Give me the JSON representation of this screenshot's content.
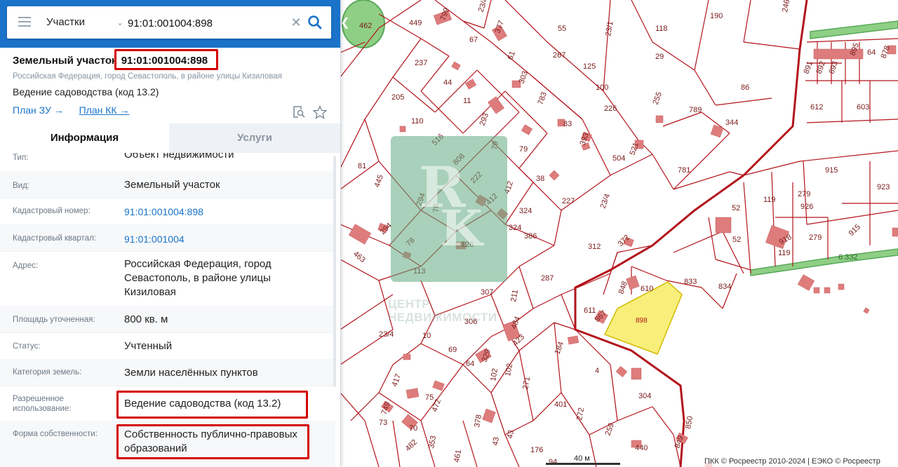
{
  "search": {
    "type_label": "Участки",
    "query": "91:01:001004:898"
  },
  "parcel": {
    "title_prefix": "Земельный участок",
    "number": "91:01:001004:898",
    "address_short": "Российская Федерация, город Севастополь, в районе улицы Кизиловая",
    "use": "Ведение садоводства (код 13.2)",
    "links": [
      "План ЗУ →",
      "План КК →"
    ]
  },
  "tabs": [
    "Информация",
    "Услуги"
  ],
  "info_rows": [
    {
      "label": "Тип:",
      "value": "Объект недвижимости"
    },
    {
      "label": "Вид:",
      "value": "Земельный участок"
    },
    {
      "label": "Кадастровый номер:",
      "value": "91:01:001004:898"
    },
    {
      "label": "Кадастровый квартал:",
      "value": "91:01:001004"
    },
    {
      "label": "Адрес:",
      "value": "Российская Федерация, город Севастополь, в районе улицы Кизиловая"
    },
    {
      "label": "Площадь уточненная:",
      "value": "800 кв. м"
    },
    {
      "label": "Статус:",
      "value": "Учтенный"
    },
    {
      "label": "Категория земель:",
      "value": "Земли населённых пунктов"
    },
    {
      "label": "Разрешенное использование:",
      "value": "Ведение садоводства (код 13.2)"
    },
    {
      "label": "Форма собственности:",
      "value": "Собственность публично-правовых образований"
    }
  ],
  "map": {
    "selected_label": "898",
    "parcel_labels": [
      "449",
      "799",
      "23/4",
      "55",
      "23/1",
      "118",
      "190",
      "246",
      "67",
      "377",
      "267",
      "29",
      "895",
      "64",
      "878",
      "891",
      "892",
      "893",
      "237",
      "61",
      "125",
      "86",
      "44",
      "303",
      "100",
      "255",
      "612",
      "603",
      "205",
      "11",
      "783",
      "226",
      "789",
      "344",
      "110",
      "293",
      "83",
      "504",
      "521",
      "81",
      "516",
      "79",
      "808",
      "79",
      "393",
      "781",
      "915",
      "923",
      "445",
      "222",
      "38",
      "227",
      "52",
      "119",
      "279",
      "926",
      "294",
      "412",
      "412",
      "324",
      "23/4",
      "324",
      "386",
      "52",
      "918",
      "119",
      "279",
      "915",
      "294",
      "78",
      "126",
      "312",
      "372",
      "463",
      "78",
      "113",
      "287",
      "848",
      "610",
      "833",
      "834",
      "6.332",
      "307",
      "211",
      "611",
      "867",
      "306",
      "484",
      "23/4",
      "10",
      "423",
      "184",
      "69",
      "64",
      "329",
      "102",
      "102",
      "4",
      "417",
      "75",
      "271",
      "401",
      "304",
      "472",
      "73",
      "749",
      "378",
      "272",
      "70",
      "259",
      "43",
      "43",
      "482",
      "353",
      "176",
      "850",
      "461",
      "440",
      "849",
      "94",
      "462"
    ],
    "scale_label": "40 м",
    "attribution": "ПКК © Росреестр 2010-2024 | ЕЭКО © Росреестр"
  },
  "watermark": {
    "text": "ЦЕНТР НЕДВИЖИМОСТИ"
  },
  "colors": {
    "header": "#1a73c9",
    "parcel_line": "#b3141c",
    "highlight": "#d40000",
    "selected_fill": "#f7ef7a",
    "building": "#de7c7c"
  }
}
